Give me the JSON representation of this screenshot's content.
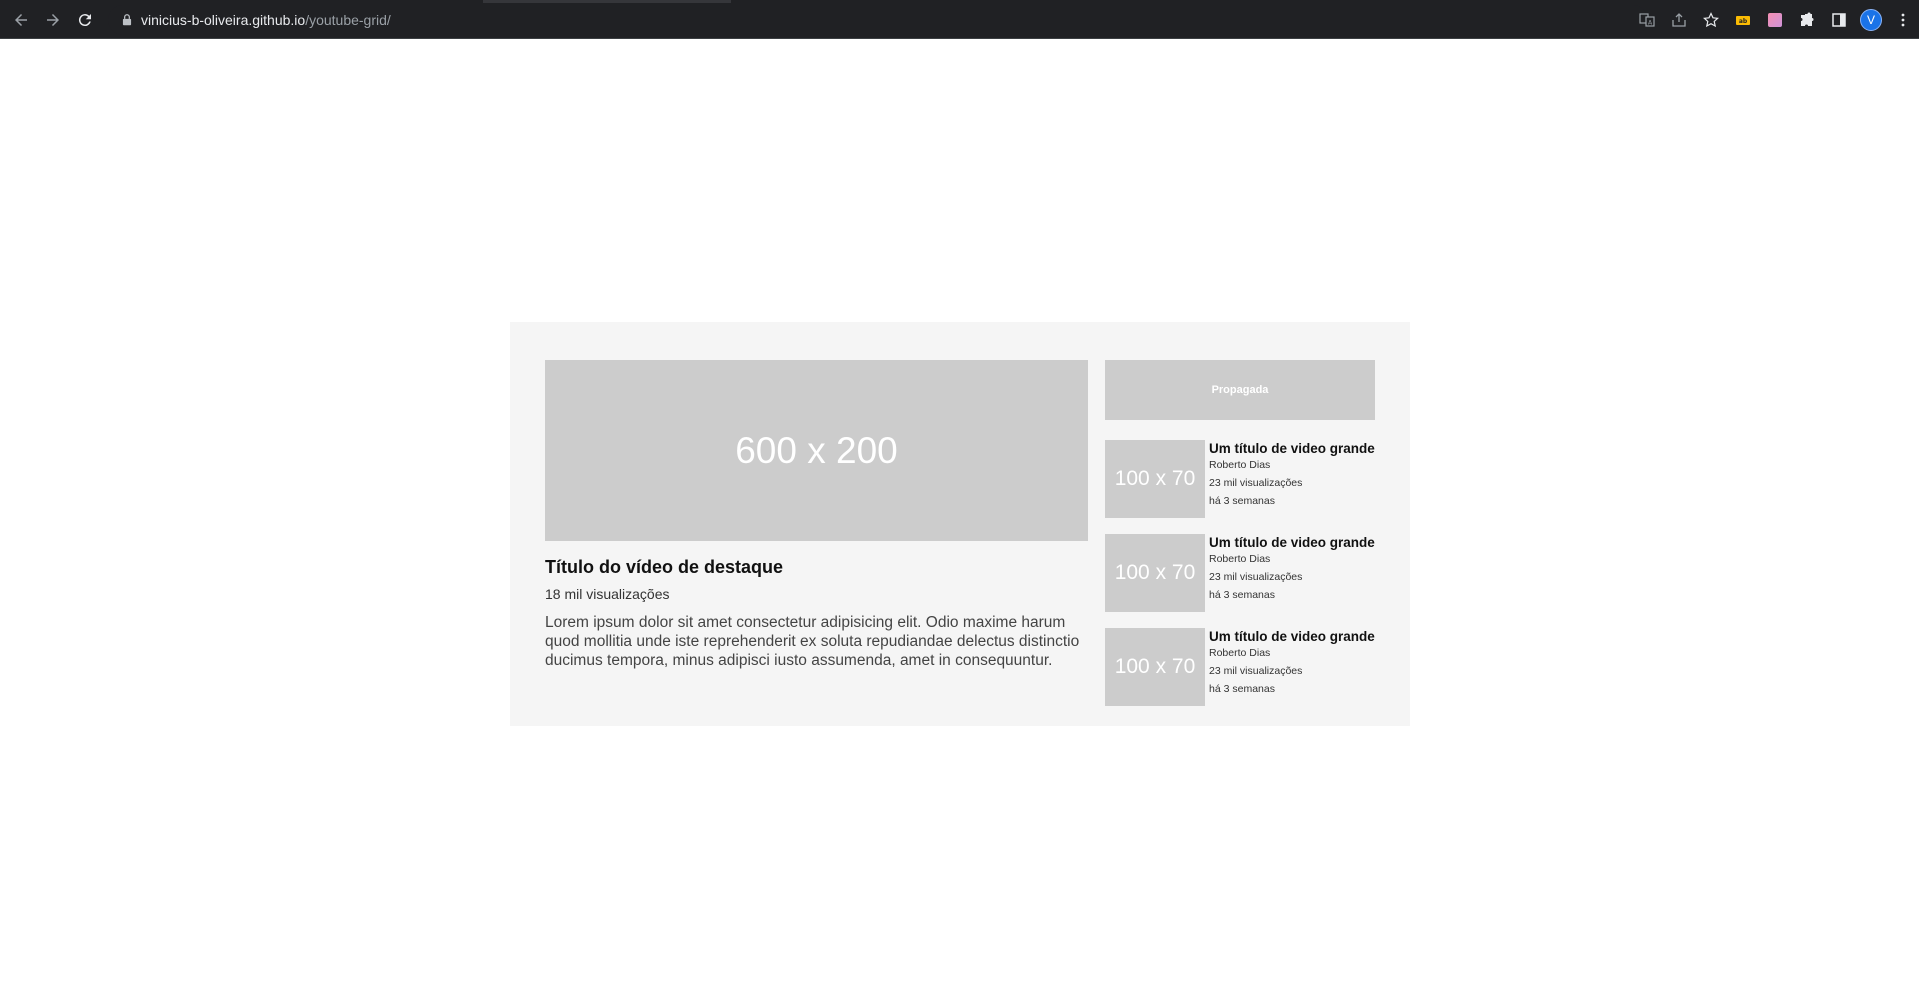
{
  "browser": {
    "url_host": "vinicius-b-oliveira.github.io",
    "url_path": "/youtube-grid/",
    "avatar_letter": "V",
    "icons": [
      "back-icon",
      "forward-icon",
      "reload-icon",
      "lock-icon",
      "translate-icon",
      "share-icon",
      "star-icon",
      "extension-ad-icon",
      "extension-color-icon",
      "extensions-puzzle-icon",
      "side-panel-icon",
      "kebab-menu-icon"
    ]
  },
  "featured": {
    "thumb_label": "600 x 200",
    "title": "Título do vídeo de destaque",
    "views": "18 mil visualizações",
    "description": "Lorem ipsum dolor sit amet consectetur adipisicing elit. Odio maxime harum quod mollitia unde iste reprehenderit ex soluta repudiandae delectus distinctio ducimus tempora, minus adipisci iusto assumenda, amet in consequuntur."
  },
  "ad": {
    "label": "Propagada"
  },
  "videos": [
    {
      "thumb_label": "100 x 70",
      "title": "Um título de video grande",
      "author": "Roberto Dias",
      "views": "23 mil visualizações",
      "age": "há 3 semanas"
    },
    {
      "thumb_label": "100 x 70",
      "title": "Um título de video grande",
      "author": "Roberto Dias",
      "views": "23 mil visualizações",
      "age": "há 3 semanas"
    },
    {
      "thumb_label": "100 x 70",
      "title": "Um título de video grande",
      "author": "Roberto Dias",
      "views": "23 mil visualizações",
      "age": "há 3 semanas"
    }
  ]
}
